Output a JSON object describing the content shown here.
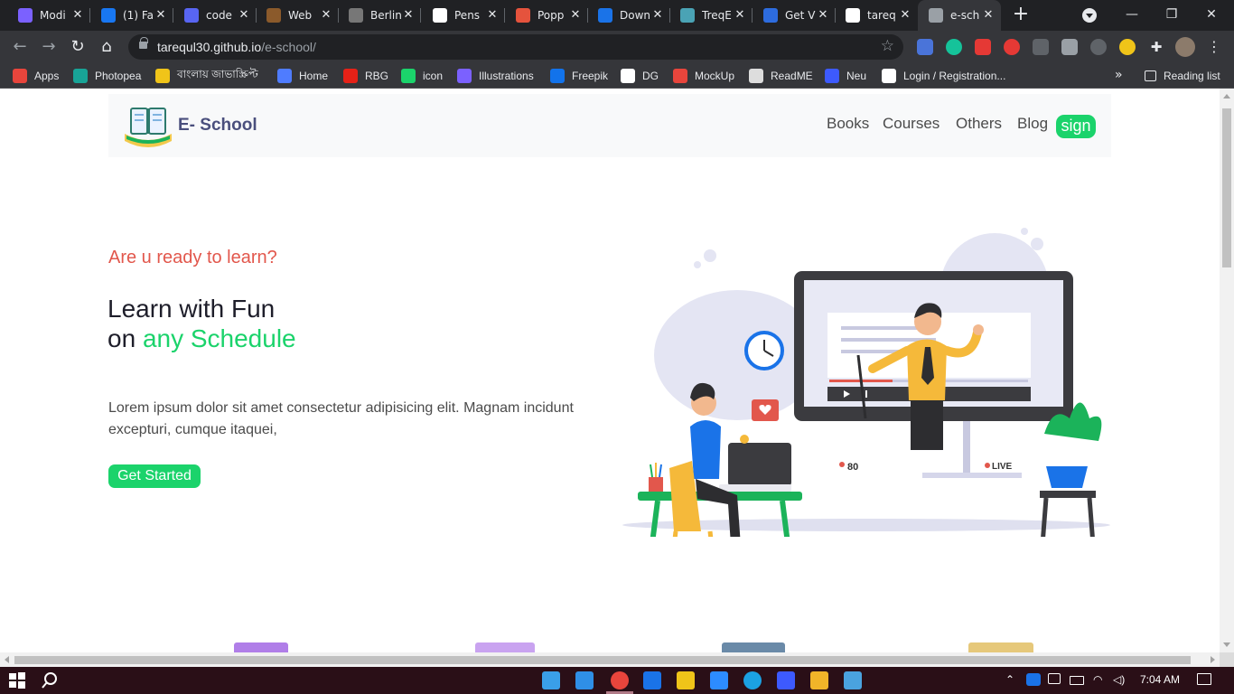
{
  "browser": {
    "tabs": [
      {
        "title": "Modi",
        "color": "#7b61ff"
      },
      {
        "title": "(1) Fa",
        "color": "#1877f2"
      },
      {
        "title": "code",
        "color": "#5865f2"
      },
      {
        "title": "Web",
        "color": "#8b5a2b"
      },
      {
        "title": "Berlin",
        "color": "#777777"
      },
      {
        "title": "Pens",
        "color": "#ffffff"
      },
      {
        "title": "Popp",
        "color": "#e5533d"
      },
      {
        "title": "Down",
        "color": "#1a73e8"
      },
      {
        "title": "TreqE",
        "color": "#4aa3b5"
      },
      {
        "title": "Get V",
        "color": "#2d6cdf"
      },
      {
        "title": "tareq",
        "color": "#ffffff"
      },
      {
        "title": "e-sch",
        "color": "#9aa0a6"
      }
    ],
    "close_glyph": "✕",
    "new_tab_glyph": "+",
    "window_controls": {
      "minimize": "—",
      "restore": "❐",
      "close": "✕"
    },
    "address": {
      "host": "tarequl30.github.io",
      "path": "/e-school/"
    },
    "bookmarks": [
      {
        "label": "Apps",
        "color": "#e8453c"
      },
      {
        "label": "Photopea",
        "color": "#18a497"
      },
      {
        "label": "বাংলায় জাভাস্ক্রিপ্ট",
        "color": "#f0c419"
      },
      {
        "label": "Home",
        "color": "#4f7cff"
      },
      {
        "label": "RBG",
        "color": "#e62117"
      },
      {
        "label": "icon",
        "color": "#1bd36b"
      },
      {
        "label": "Illustrations",
        "color": "#7b61ff"
      },
      {
        "label": "Freepik",
        "color": "#1273eb"
      },
      {
        "label": "DG",
        "color": "#ffffff"
      },
      {
        "label": "MockUp",
        "color": "#e8453c"
      },
      {
        "label": "ReadME",
        "color": "#dddddd"
      },
      {
        "label": "Neu",
        "color": "#3d5afe"
      },
      {
        "label": "Login / Registration...",
        "color": "#ffffff"
      }
    ],
    "bookmarks_more": "»",
    "reading_list": "Reading list"
  },
  "site": {
    "logo_text": "E- School",
    "nav": [
      "Books",
      "Courses",
      "Others",
      "Blog"
    ],
    "sign_label": "sign",
    "accent": "#1bd36b",
    "hero": {
      "eyebrow": "Are u ready to learn?",
      "title_line1": "Learn with Fun",
      "title_line2_prefix": "on ",
      "title_line2_highlight": "any Schedule",
      "lead": "Lorem ipsum dolor sit amet consectetur adipisicing elit. Magnam incidunt excepturi, cumque itaquei,",
      "cta": "Get Started"
    },
    "illustration": {
      "viewer_count": "80",
      "live_label": "LIVE"
    }
  },
  "taskbar": {
    "clock": "7:04 AM",
    "apps": [
      "file-explorer-desktop",
      "vscode",
      "chrome",
      "teamviewer",
      "node",
      "zoom",
      "edge",
      "wps",
      "files",
      "photos"
    ]
  }
}
